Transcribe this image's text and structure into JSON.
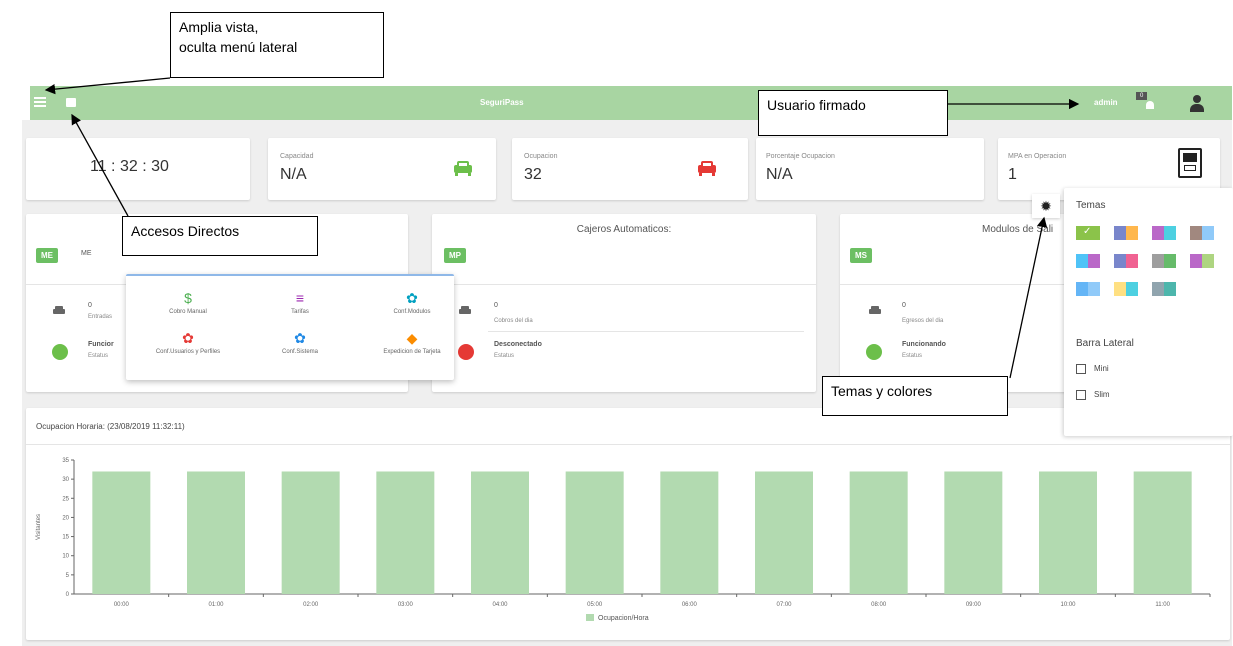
{
  "topbar": {
    "title": "SeguriPass",
    "user": "admin",
    "notif_count": "0"
  },
  "callouts": {
    "amplia": "Amplia vista,\noculta menú lateral",
    "usuario": "Usuario firmado",
    "accesos": "Accesos Directos",
    "temas": "Temas y colores"
  },
  "stats": {
    "clock": "11 : 32 : 30",
    "capacidad": {
      "label": "Capacidad",
      "value": "N/A"
    },
    "ocupacion": {
      "label": "Ocupacion",
      "value": "32"
    },
    "porcentaje": {
      "label": "Porcentaje Ocupacion",
      "value": "N/A"
    },
    "mpa": {
      "label": "MPA en Operacion",
      "value": "1"
    }
  },
  "panels": {
    "me": {
      "badge": "ME",
      "label": "ME",
      "count": "0",
      "count_label": "Entradas",
      "status": "Funcior",
      "status_label": "Estatus"
    },
    "mp": {
      "title": "Cajeros Automaticos:",
      "badge": "MP",
      "count": "0",
      "count_label": "Cobros del dia",
      "status": "Desconectado",
      "status_label": "Estatus"
    },
    "ms": {
      "title": "Modulos de Sali",
      "badge": "MS",
      "count": "0",
      "count_label": "Egresos del dia",
      "status": "Funcionando",
      "status_label": "Estatus"
    }
  },
  "quick": [
    {
      "label": "Cobro Manual",
      "icon": "dollar-icon",
      "glyph": "$",
      "color": "#4caf50"
    },
    {
      "label": "Tarifas",
      "icon": "list-icon",
      "glyph": "≡",
      "color": "#9c27b0"
    },
    {
      "label": "Conf.Modulos",
      "icon": "gear-icon",
      "glyph": "✿",
      "color": "#00a0c0"
    },
    {
      "label": "Conf.Usuarios y Perfiles",
      "icon": "gear-icon",
      "glyph": "✿",
      "color": "#e53935"
    },
    {
      "label": "Conf.Sistema",
      "icon": "gear-icon",
      "glyph": "✿",
      "color": "#1e88e5"
    },
    {
      "label": "Expedicion de Tarjeta",
      "icon": "tag-icon",
      "glyph": "◆",
      "color": "#fb8c00"
    }
  ],
  "themes": {
    "title": "Temas",
    "sidebar_title": "Barra Lateral",
    "mini": "Mini",
    "slim": "Slim",
    "swatches": [
      [
        "#8bc34a",
        "#8bc34a"
      ],
      [
        "#7986cb",
        "#ffb74d"
      ],
      [
        "#ba68c8",
        "#4dd0e1"
      ],
      [
        "#a1887f",
        "#90caf9"
      ],
      [
        "#4fc3f7",
        "#ba68c8"
      ],
      [
        "#7986cb",
        "#f06292"
      ],
      [
        "#9e9e9e",
        "#66bb6a"
      ],
      [
        "#ba68c8",
        "#aed581"
      ],
      [
        "#64b5f6",
        "#90caf9"
      ],
      [
        "#ffe082",
        "#4dd0e1"
      ],
      [
        "#90a4ae",
        "#4db6ac"
      ]
    ]
  },
  "chart_data": {
    "type": "bar",
    "title": "Ocupacion Horaria: (23/08/2019 11:32:11)",
    "ylabel": "Visitantes",
    "categories": [
      "00:00",
      "01:00",
      "02:00",
      "03:00",
      "04:00",
      "05:00",
      "06:00",
      "07:00",
      "08:00",
      "09:00",
      "10:00",
      "11:00"
    ],
    "series": [
      {
        "name": "Ocupacion/Hora",
        "values": [
          32,
          32,
          32,
          32,
          32,
          32,
          32,
          32,
          32,
          32,
          32,
          32
        ]
      }
    ],
    "ylim": [
      0,
      35
    ],
    "yticks": [
      "0",
      "5",
      "10",
      "15",
      "20",
      "25",
      "30",
      "35"
    ],
    "color": "#b2dab0"
  }
}
